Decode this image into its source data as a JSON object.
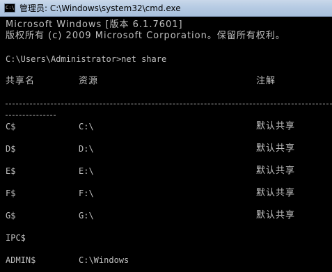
{
  "window": {
    "title": "管理员: C:\\Windows\\system32\\cmd.exe",
    "icon": "console-icon",
    "icon_text": "C:\\"
  },
  "console": {
    "banner_line1": "Microsoft Windows [版本 6.1.7601]",
    "banner_line2": "版权所有 (c) 2009 Microsoft Corporation。保留所有权利。",
    "prompt": "C:\\Users\\Administrator>net share",
    "headers": {
      "share_name": "共享名",
      "resource": "资源",
      "remark": "注解"
    },
    "separator": "-------------------------------------------------------------------------------",
    "shares": [
      {
        "name": "C$",
        "resource": "C:\\",
        "remark": "默认共享"
      },
      {
        "name": "D$",
        "resource": "D:\\",
        "remark": "默认共享"
      },
      {
        "name": "E$",
        "resource": "E:\\",
        "remark": "默认共享"
      },
      {
        "name": "F$",
        "resource": "F:\\",
        "remark": "默认共享"
      },
      {
        "name": "G$",
        "resource": "G:\\",
        "remark": "默认共享"
      },
      {
        "name": "IPC$",
        "resource": "",
        "remark": ""
      },
      {
        "name": "ADMIN$",
        "resource": "C:\\Windows",
        "remark": ""
      }
    ]
  }
}
